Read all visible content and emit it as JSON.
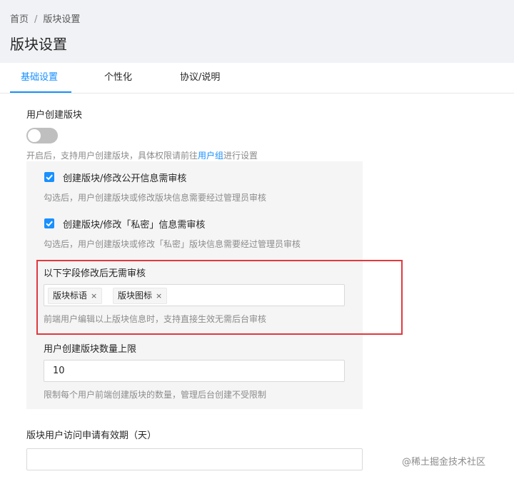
{
  "breadcrumb": {
    "home": "首页",
    "sep": "/",
    "current": "版块设置"
  },
  "page_title": "版块设置",
  "tabs": [
    {
      "label": "基础设置",
      "active": true
    },
    {
      "label": "个性化",
      "active": false
    },
    {
      "label": "协议/说明",
      "active": false
    }
  ],
  "user_create": {
    "label": "用户创建版块",
    "enabled": false,
    "help_prefix": "开启后，支持用户创建版块，具体权限请前往",
    "help_link": "用户组",
    "help_suffix": "进行设置"
  },
  "review_public": {
    "checked": true,
    "label": "创建版块/修改公开信息需审核",
    "help": "勾选后，用户创建版块或修改版块信息需要经过管理员审核"
  },
  "review_private": {
    "checked": true,
    "label": "创建版块/修改「私密」信息需审核",
    "help": "勾选后，用户创建版块或修改「私密」版块信息需要经过管理员审核"
  },
  "no_review_fields": {
    "label": "以下字段修改后无需审核",
    "tags": [
      "版块标语",
      "版块图标"
    ],
    "tag_close": "×",
    "help": "前端用户编辑以上版块信息时，支持直接生效无需后台审核"
  },
  "limit": {
    "label": "用户创建版块数量上限",
    "value": "10",
    "help": "限制每个用户前端创建版块的数量，管理后台创建不受限制"
  },
  "access_expiry": {
    "label": "版块用户访问申请有效期（天）"
  },
  "watermark": "@稀土掘金技术社区",
  "colors": {
    "accent": "#1890ff",
    "highlight_border": "#e0393e",
    "switch_off": "#bfbfbf"
  }
}
